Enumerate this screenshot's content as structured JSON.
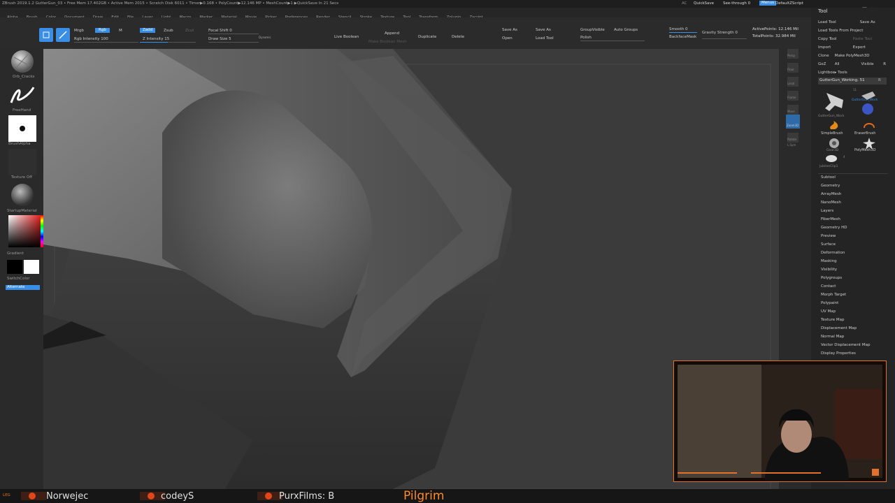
{
  "title_bar": {
    "text": "ZBrush 2019.1.2   GutterGun_03   • Free Mem 17.402GB • Active Mem 2015 • Scratch Disk 6011 • Timer▶0.168 • PolyCount▶12.146 MP • MeshCount▶1 ▶QuickSave In 21 Secs",
    "ac": "AC",
    "quicksave": "QuickSave",
    "see_through": "See-through 0",
    "menus": "Menus",
    "default_zscript": "DefaultZScript"
  },
  "menu_items": [
    "Alpha",
    "Brush",
    "Color",
    "Document",
    "Draw",
    "Edit",
    "File",
    "Layer",
    "Light",
    "Macro",
    "Marker",
    "Material",
    "Movie",
    "Picker",
    "Preferences",
    "Render",
    "Stencil",
    "Stroke",
    "Texture",
    "Tool",
    "Transform",
    "Zplugin",
    "Zscript"
  ],
  "top_shelf": {
    "mrgb": "Mrgb",
    "rgb": "Rgb",
    "m": "M",
    "rgb_intensity": "Rgb Intensity 100",
    "zadd": "Zadd",
    "zsub": "Zsub",
    "zcut": "Zcut",
    "z_intensity": "Z Intensity 15",
    "focal_shift": "Focal Shift 0",
    "draw_size": "Draw Size 5",
    "dynamic": "Dynamic",
    "live_boolean": "Live Boolean",
    "append": "Append",
    "make_boolean_mesh": "Make Boolean Mesh",
    "duplicate": "Duplicate",
    "delete": "Delete",
    "save_as_1": "Save As",
    "open": "Open",
    "save_as_2": "Save As",
    "load_tool": "Load Tool",
    "group_visible": "GroupVisible",
    "auto_groups": "Auto Groups",
    "polish": "Polish",
    "smooth": "Smooth 0",
    "backface_mask": "BackfaceMask",
    "gravity_strength": "Gravity Strength 0",
    "active_points": "ActivePoints: 12.146 Mil",
    "total_points": "TotalPoints: 32.984 Mil"
  },
  "left_shelf": {
    "brush": "Orb_Cracks",
    "stroke": "FreeHand",
    "alpha": "BrushAlpha",
    "texture": "Texture Off",
    "material": "StartupMaterial",
    "gradient": "Gradient",
    "switch_color": "SwitchColor",
    "alternate": "Alternate"
  },
  "tool_palette": {
    "title": "Tool",
    "row1": [
      "Load Tool",
      "Save As"
    ],
    "row2": [
      "Load Tools From Project"
    ],
    "row3": [
      "Copy Tool",
      "Paste Tool"
    ],
    "row4": [
      "Import",
      "Export"
    ],
    "row5": [
      "Clone",
      "Make PolyMesh3D"
    ],
    "row6": [
      "GoZ",
      "All",
      "Visible",
      "R"
    ],
    "lightbox": "Lightbox▸ Tools",
    "current_tool": "GutterGun_Working. 51",
    "r": "R",
    "thumbs": [
      "GutterGun_Work",
      "GutterGun_Work",
      "SimpleBrush",
      "EraserBrush",
      "Gear3D",
      "PolyMesh3D",
      "JubileeClip1"
    ],
    "thumb_counts": [
      "11",
      "4"
    ],
    "subpalettes": [
      "Subtool",
      "Geometry",
      "ArrayMesh",
      "NanoMesh",
      "Layers",
      "FiberMesh",
      "Geometry HD",
      "Preview",
      "Surface",
      "Deformation",
      "Masking",
      "Visibility",
      "Polygroups",
      "Contact",
      "Morph Target",
      "Polypaint",
      "UV Map",
      "Texture Map",
      "Displacement Map",
      "Normal Map",
      "Vector Displacement Map",
      "Display Properties"
    ]
  },
  "right_shelf": {
    "labels": [
      "Persp",
      "Floor",
      "Local",
      "Frame",
      "Move",
      "Zoom3D",
      "Rotate",
      "L.Sym"
    ]
  },
  "bottom_bar": {
    "items": [
      {
        "badge": "LEG",
        "name": "Norwejec"
      },
      {
        "badge": "",
        "name": "codeyS"
      },
      {
        "badge": "",
        "name": "PurxFilms: B"
      }
    ],
    "title": "Pilgrim"
  },
  "colors": {
    "accent": "#3a8ee6",
    "stream_orange": "#e2712b",
    "background": "#2a2a2a",
    "canvas": "#3b3b3b"
  }
}
